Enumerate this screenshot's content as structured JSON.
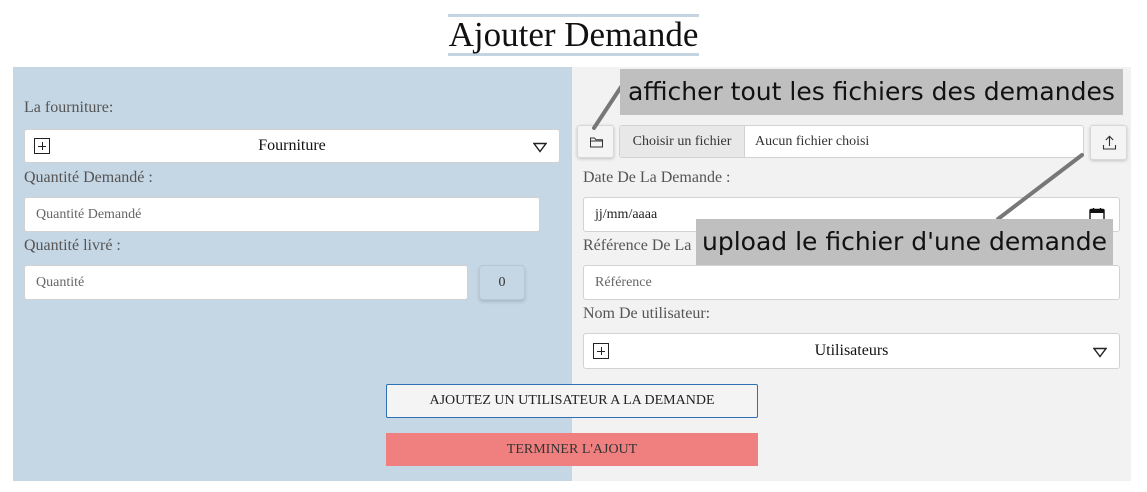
{
  "page": {
    "title": "Ajouter Demande"
  },
  "left": {
    "fourniture_label": "La fourniture:",
    "fourniture_select": "Fourniture",
    "quantite_demandee_label": "Quantité Demandé :",
    "quantite_demandee_placeholder": "Quantité Demandé",
    "quantite_livree_label": "Quantité livré :",
    "quantite_placeholder": "Quantité",
    "quantite_count": "0"
  },
  "right": {
    "file_choose_label": "Choisir un fichier",
    "file_none_label": "Aucun fichier choisi",
    "date_label": "Date De La Demande :",
    "date_placeholder": "jj/mm/aaaa",
    "reference_label": "Référence De La",
    "reference_placeholder": "Référence",
    "user_label": "Nom De utilisateur:",
    "user_select": "Utilisateurs"
  },
  "actions": {
    "add_user_label": "AJOUTEZ UN UTILISATEUR A LA DEMANDE",
    "finish_label": "TERMINER L'AJOUT"
  },
  "annotations": {
    "folder_tip": "afficher tout les fichiers des demandes",
    "upload_tip": "upload le fichier d'une demande"
  },
  "icons": {
    "folder": "folder-icon",
    "upload": "upload-icon",
    "calendar": "calendar-icon",
    "plus_box": "plus-square-icon",
    "caret": "triangle-down-icon"
  },
  "colors": {
    "left_panel": "#c5d6e4",
    "right_panel": "#f2f2f2",
    "finish_button": "#f08080",
    "add_button_border": "#2f6fb3",
    "tooltip_bg": "#bfbfbf"
  }
}
